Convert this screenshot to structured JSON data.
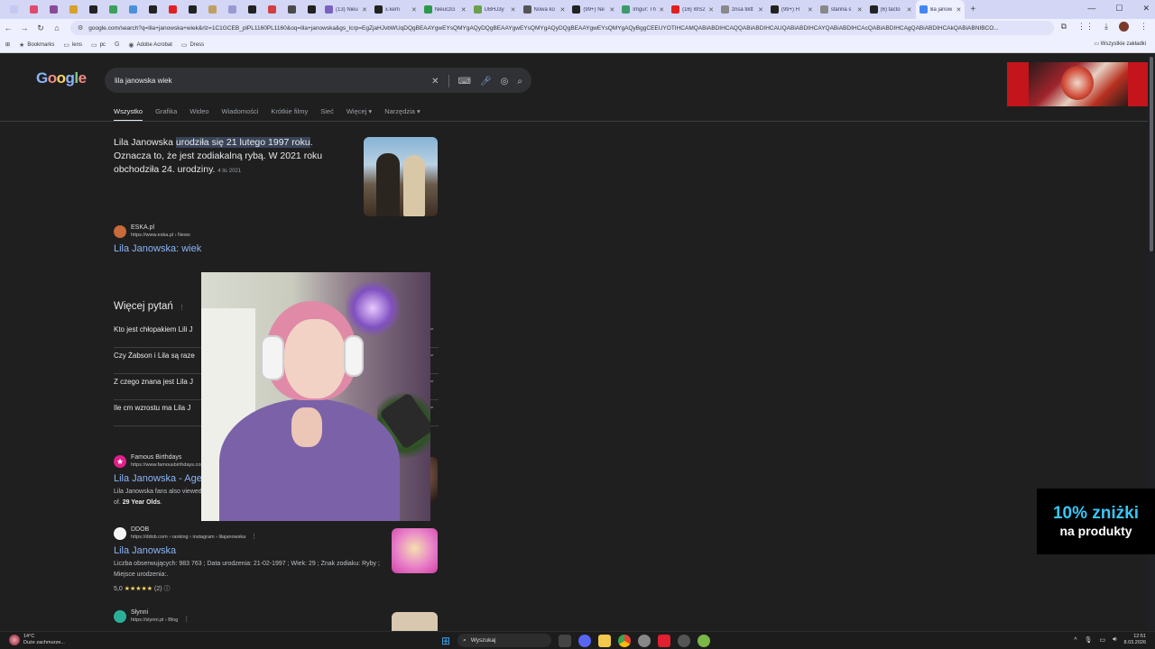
{
  "browser": {
    "tabs": [
      {
        "label": "",
        "color": "#c5c8f0",
        "small": true
      },
      {
        "label": "",
        "color": "#e04a6a",
        "small": true
      },
      {
        "label": "",
        "color": "#8a4a9a",
        "small": true
      },
      {
        "label": "",
        "color": "#d9a02a",
        "small": true
      },
      {
        "label": "",
        "color": "#222222",
        "small": true
      },
      {
        "label": "",
        "color": "#3aa05a",
        "small": true
      },
      {
        "label": "",
        "color": "#4a90d9",
        "small": true
      },
      {
        "label": "",
        "color": "#222222",
        "small": true
      },
      {
        "label": "",
        "color": "#e02020",
        "small": true
      },
      {
        "label": "",
        "color": "#222222",
        "small": true
      },
      {
        "label": "",
        "color": "#c0a060",
        "small": true
      },
      {
        "label": "",
        "color": "#9a9ad0",
        "small": true
      },
      {
        "label": "",
        "color": "#222222",
        "small": true
      },
      {
        "label": "",
        "color": "#d04040",
        "small": true
      },
      {
        "label": "",
        "color": "#4a4a4a",
        "small": true
      },
      {
        "label": "",
        "color": "#222222",
        "small": true
      },
      {
        "label": "(13) Nieu",
        "color": "#7b61c0",
        "small": false
      },
      {
        "label": "x.kem",
        "color": "#222222",
        "small": false
      },
      {
        "label": "Nieuczci",
        "color": "#2a9a4a",
        "small": false
      },
      {
        "label": "UBHJ3y",
        "color": "#6aa04a",
        "small": false
      },
      {
        "label": "Nowa ko",
        "color": "#555555",
        "small": false
      },
      {
        "label": "(99+) Ne",
        "color": "#222222",
        "small": false
      },
      {
        "label": "Imgur: Th",
        "color": "#3a9a6a",
        "small": false
      },
      {
        "label": "(16) WS2",
        "color": "#e02020",
        "small": false
      },
      {
        "label": "zrisa tiktt",
        "color": "#888888",
        "small": false
      },
      {
        "label": "(99+) H",
        "color": "#222222",
        "small": false
      },
      {
        "label": "starina s",
        "color": "#888888",
        "small": false
      },
      {
        "label": "(6) tacto",
        "color": "#222222",
        "small": false
      },
      {
        "label": "lila janow",
        "color": "#4285f4",
        "small": false,
        "active": true
      }
    ],
    "url": "google.com/search?q=lila+janowska+wiek&rlz=1C1GCEB_plPL1160PL1160&oq=lila+janowska&gs_lcrp=EgZjaHJvbWUqDQgBEAAYgwEYsQMYgAQyDQgBEAAYgwEYsQMYgAQyDQgBEAAYgwEYsQMYgAQyBggCEEUYOTIHCAMQABiABDIHCAQQABiABDIHCAUQABiABDIHCAYQABiABDIHCAcQABiABDIHCAgQABiABDIHCAkQABiABNIBCO...",
    "bookmarks": [
      {
        "icon": "star-icon",
        "label": "Bookmarks"
      },
      {
        "icon": "folder-icon",
        "label": "lens"
      },
      {
        "icon": "folder-icon",
        "label": "pc"
      },
      {
        "icon": "google-icon",
        "label": ""
      },
      {
        "icon": "acrobat-icon",
        "label": "Adobe Acrobat"
      },
      {
        "icon": "folder-icon",
        "label": "Dress"
      }
    ],
    "all_bookmarks": "Wszystkie zakładki"
  },
  "google": {
    "query": "lila janowska wiek",
    "tabs": [
      "Wszystko",
      "Grafika",
      "Wideo",
      "Wiadomości",
      "Krótkie filmy",
      "Sieć",
      "Więcej ▾",
      "Narzędzia ▾"
    ],
    "snippet": {
      "pre": "Lila Janowska ",
      "highlight": "urodziła się 21 lutego 1997 roku",
      "post": ". Oznacza to, że jest zodiakalną rybą. W 2021 roku obchodziła 24. urodziny.",
      "date": "4 lis 2021"
    },
    "eska": {
      "name": "ESKA.pl",
      "url": "https://www.eska.pl › News",
      "title": "Lila Janowska: wiek"
    },
    "paa_title": "Więcej pytań",
    "paa": [
      "Kto jest chłopakiem Lili J",
      "Czy Żabson i Lila są raze",
      "Z czego znana jest Lila J",
      "Ile cm wzrostu ma Lila J"
    ],
    "famous": {
      "name": "Famous Birthdays",
      "url": "https://www.famousbirthdays.com",
      "title": "Lila Janowska - Age, Bio, Family",
      "desc_a": "Lila Janowska fans also viewed. Maja Janowska. Instagram Star ... Lila Janowska is a member of. ",
      "desc_b": "29 Year Olds",
      "desc_c": "."
    },
    "ddob": {
      "name": "DDOB",
      "url": "https://ddob.com › ranking › instagram › lilajanowska",
      "title": "Lila Janowska",
      "desc": "Liczba obserwujących: 983 763 ; Data urodzenia: 21-02-1997 ; Wiek: 29 ; Znak zodiaku: Ryby ; Miejsce urodzenia:.",
      "rating": "5,0",
      "stars": "★★★★★",
      "reviews": "(2)"
    },
    "slynni": {
      "name": "Słynni",
      "url": "https://slynni.pl › Blog"
    }
  },
  "promo": {
    "line1": "10% zniżki",
    "line2": "na produkty"
  },
  "taskbar": {
    "weather_temp": "14°C",
    "weather_desc": "Duże zachmurze...",
    "search": "Wyszukaj",
    "time": "12:51",
    "date": "8.03.2026"
  }
}
